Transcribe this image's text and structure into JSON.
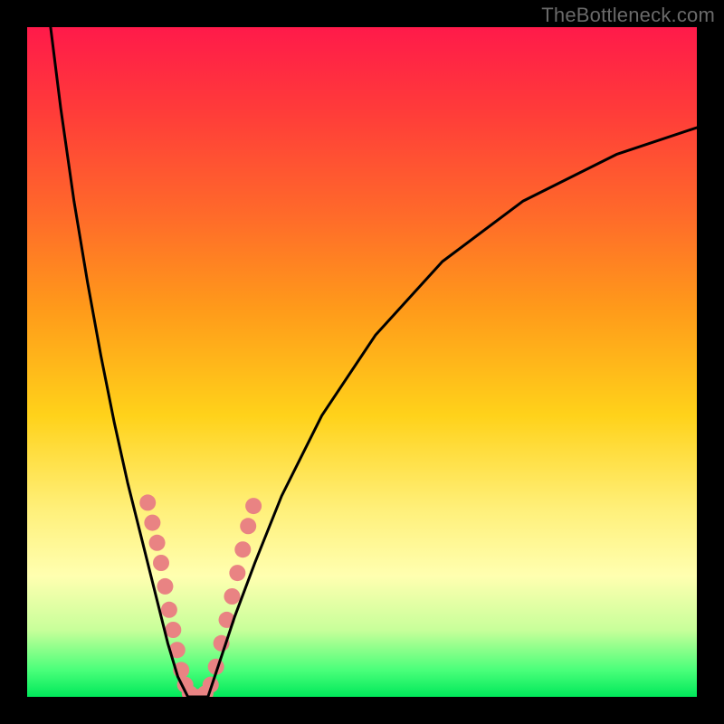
{
  "meta": {
    "watermark": "TheBottleneck.com"
  },
  "chart_data": {
    "type": "line",
    "title": "",
    "xlabel": "",
    "ylabel": "",
    "xlim": [
      0,
      100
    ],
    "ylim": [
      0,
      100
    ],
    "grid": false,
    "legend": null,
    "background_gradient": {
      "direction": "vertical",
      "stops": [
        {
          "pos": 0.0,
          "color": "#ff1a4a"
        },
        {
          "pos": 0.12,
          "color": "#ff3a3a"
        },
        {
          "pos": 0.28,
          "color": "#ff6a2a"
        },
        {
          "pos": 0.42,
          "color": "#ff9a1a"
        },
        {
          "pos": 0.58,
          "color": "#ffd21a"
        },
        {
          "pos": 0.72,
          "color": "#fff07a"
        },
        {
          "pos": 0.82,
          "color": "#ffffb0"
        },
        {
          "pos": 0.9,
          "color": "#c8ff9a"
        },
        {
          "pos": 0.96,
          "color": "#4aff7a"
        },
        {
          "pos": 1.0,
          "color": "#00e85a"
        }
      ]
    },
    "series": [
      {
        "name": "left-curve",
        "color": "#000000",
        "x": [
          3.5,
          5.0,
          7.0,
          9.0,
          11.0,
          13.0,
          15.0,
          17.0,
          19.0,
          21.0,
          22.5,
          24.0
        ],
        "y": [
          100.0,
          88.0,
          74.0,
          62.0,
          51.0,
          41.0,
          32.0,
          24.0,
          16.0,
          8.0,
          3.0,
          0.0
        ]
      },
      {
        "name": "right-curve",
        "color": "#000000",
        "x": [
          27.0,
          29.0,
          31.0,
          34.0,
          38.0,
          44.0,
          52.0,
          62.0,
          74.0,
          88.0,
          100.0
        ],
        "y": [
          0.0,
          6.0,
          12.0,
          20.0,
          30.0,
          42.0,
          54.0,
          65.0,
          74.0,
          81.0,
          85.0
        ]
      },
      {
        "name": "valley-floor",
        "color": "#000000",
        "x": [
          24.0,
          25.5,
          27.0
        ],
        "y": [
          0.0,
          0.0,
          0.0
        ]
      }
    ],
    "markers": {
      "name": "highlight-dots",
      "color": "#e98383",
      "radius": 9,
      "points": [
        {
          "x": 18.0,
          "y": 29.0
        },
        {
          "x": 18.7,
          "y": 26.0
        },
        {
          "x": 19.4,
          "y": 23.0
        },
        {
          "x": 20.0,
          "y": 20.0
        },
        {
          "x": 20.6,
          "y": 16.5
        },
        {
          "x": 21.2,
          "y": 13.0
        },
        {
          "x": 21.8,
          "y": 10.0
        },
        {
          "x": 22.4,
          "y": 7.0
        },
        {
          "x": 23.0,
          "y": 4.0
        },
        {
          "x": 23.6,
          "y": 1.8
        },
        {
          "x": 24.3,
          "y": 0.5
        },
        {
          "x": 25.0,
          "y": 0.0
        },
        {
          "x": 25.8,
          "y": 0.0
        },
        {
          "x": 26.6,
          "y": 0.5
        },
        {
          "x": 27.4,
          "y": 1.8
        },
        {
          "x": 28.2,
          "y": 4.5
        },
        {
          "x": 29.0,
          "y": 8.0
        },
        {
          "x": 29.8,
          "y": 11.5
        },
        {
          "x": 30.6,
          "y": 15.0
        },
        {
          "x": 31.4,
          "y": 18.5
        },
        {
          "x": 32.2,
          "y": 22.0
        },
        {
          "x": 33.0,
          "y": 25.5
        },
        {
          "x": 33.8,
          "y": 28.5
        }
      ]
    }
  }
}
